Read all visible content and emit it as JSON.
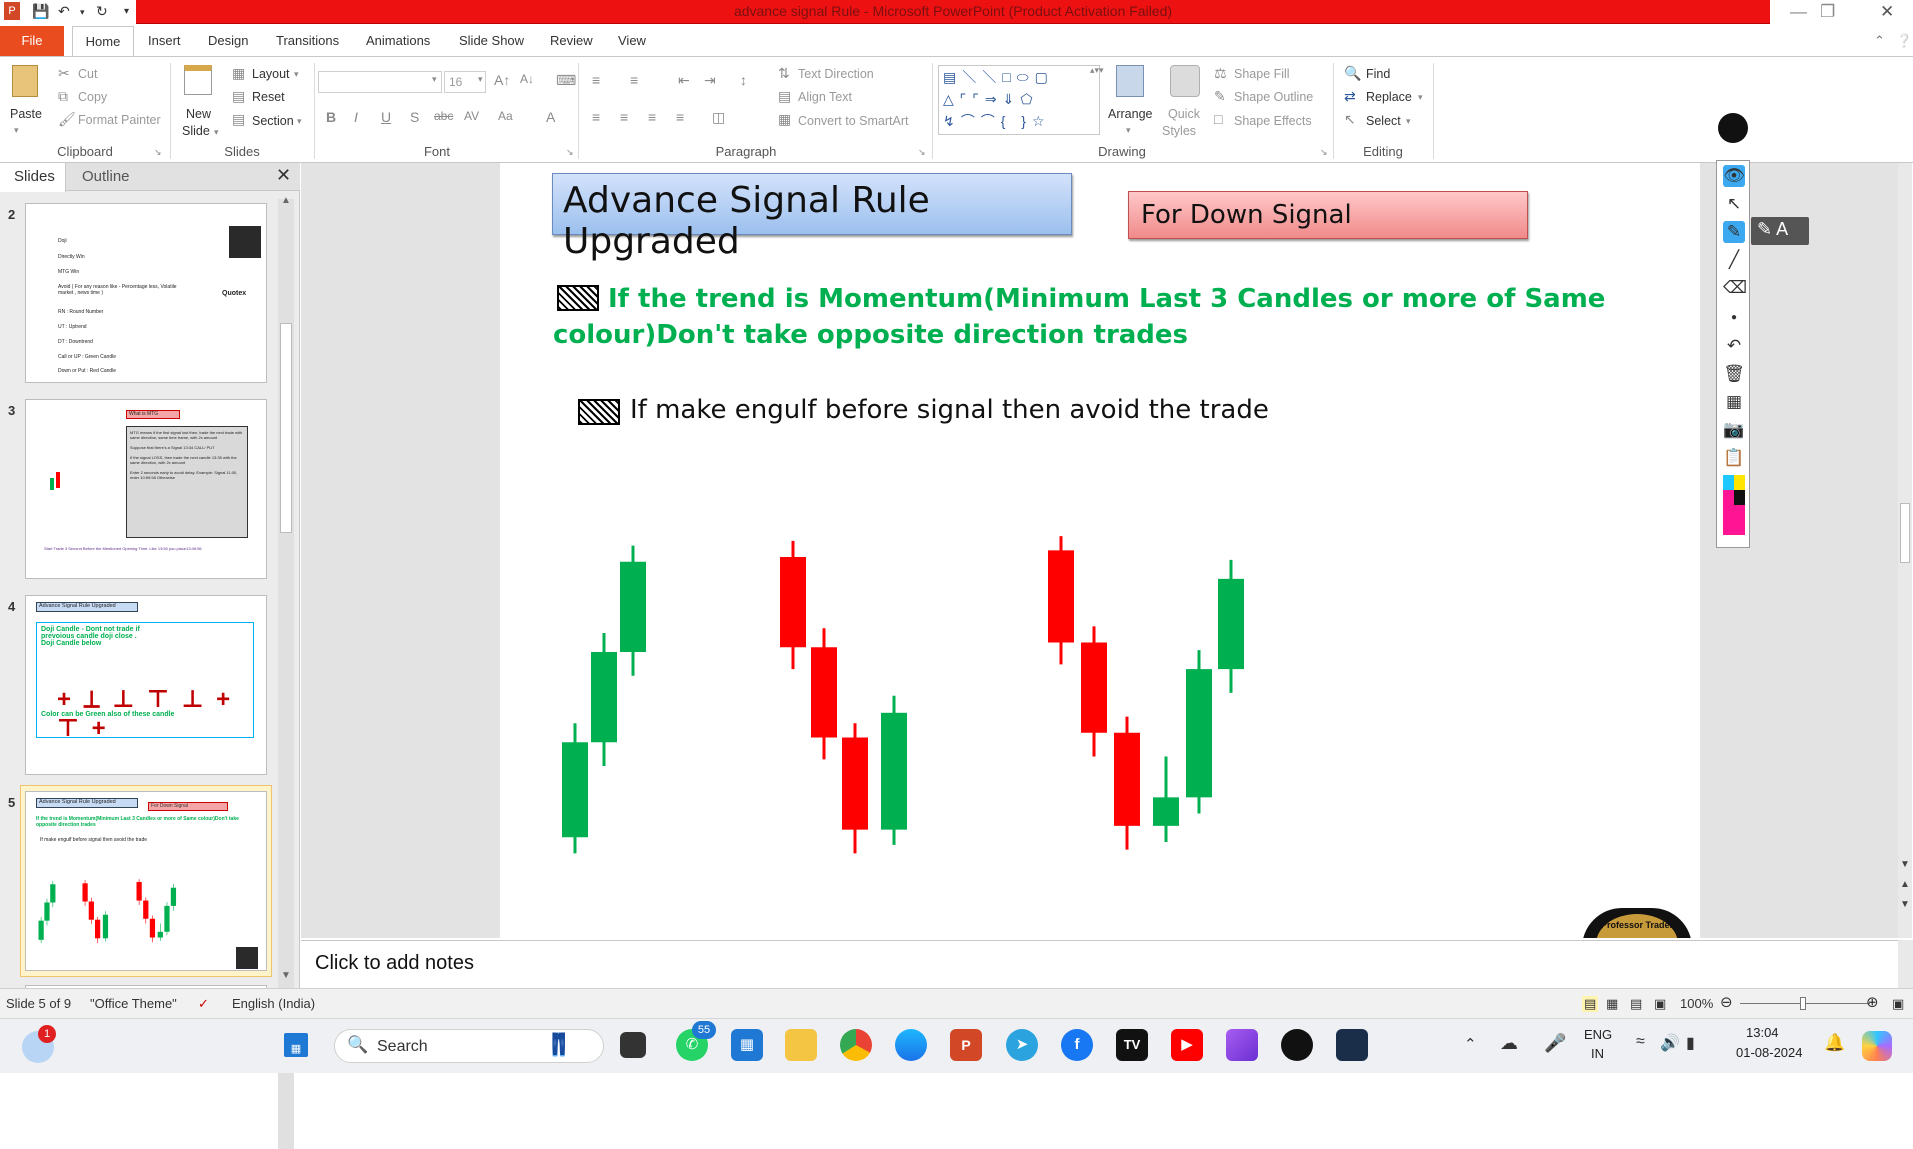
{
  "window": {
    "title": "advance signal Rule  -  Microsoft PowerPoint (Product Activation Failed)"
  },
  "tabs": [
    "File",
    "Home",
    "Insert",
    "Design",
    "Transitions",
    "Animations",
    "Slide Show",
    "Review",
    "View"
  ],
  "ribbon": {
    "clipboard": {
      "group": "Clipboard",
      "paste": "Paste",
      "cut": "Cut",
      "copy": "Copy",
      "format_painter": "Format Painter"
    },
    "slides": {
      "group": "Slides",
      "new_slide_1": "New",
      "new_slide_2": "Slide",
      "layout": "Layout",
      "reset": "Reset",
      "section": "Section"
    },
    "font": {
      "group": "Font",
      "size": "16"
    },
    "paragraph": {
      "group": "Paragraph",
      "text_direction": "Text Direction",
      "align_text": "Align Text",
      "convert": "Convert to SmartArt"
    },
    "drawing": {
      "group": "Drawing",
      "arrange": "Arrange",
      "quick_1": "Quick",
      "quick_2": "Styles",
      "shape_fill": "Shape Fill",
      "shape_outline": "Shape Outline",
      "shape_effects": "Shape Effects"
    },
    "editing": {
      "group": "Editing",
      "find": "Find",
      "replace": "Replace",
      "select": "Select"
    }
  },
  "pane": {
    "tab_slides": "Slides",
    "tab_outline": "Outline"
  },
  "thumbs": {
    "n2": "2",
    "n3": "3",
    "n4": "4",
    "n5": "5",
    "t2": {
      "l1": "Doji",
      "l2": "Directly Win",
      "l3": "MTG Win",
      "l4": "Avoid ( For any reason like - Percentage less, Volatile market , news time )",
      "l5": "RN : Round Number",
      "l6": "UT : Uptrend",
      "l7": "DT : Downtrend",
      "l8": "Call or UP  : Green Candle",
      "l9": "Down or Put  : Red Candle",
      "brand": "Quotex"
    },
    "t3": {
      "title": "What is MTG",
      "b1": "MTG means if the first signal lost  then, trade the next trade with same direction, same time frame, with 2x amount",
      "b2": "Suppose that there's a Signal 13:34 CALL/ PUT",
      "b3": "If the signal LOSS, then trade the next candle 13:35 with the same direction, with 2x amount",
      "b4": "Enter 2 seconds early to avoid delay. Example: Signal 11:00, enter 10:59:58 Otherwise",
      "foot": "Start Trade 3 Second Before the Mentioned  Opening Time, Like 13:50 you place13:49:56"
    },
    "t4": {
      "title": "Advance Signal Rule Upgraded",
      "t1": "Doji Candle - Dont not trade if prevoious candle doji close . Doji Candle below",
      "t2": "Color can be Green also of these candle"
    },
    "t5": {
      "title": "Advance Signal Rule Upgraded",
      "tag": "For Down Signal",
      "l1": "If the trend is Momentum(Minimum  Last 3 Candles  or more of Same colour)Don't take opposite  direction  trades",
      "l2": "If make engulf before  signal then avoid the trade"
    }
  },
  "slide": {
    "title": "Advance Signal Rule Upgraded",
    "tag": "For Down Signal",
    "rule1": "If  the trend is Momentum(Minimum  Last 3 Candles  or more of Same colour)Don't take opposite direction trades",
    "rule2": "If make engulf before  signal then avoid the trade",
    "logo_text": "Professor Trader"
  },
  "candles": [
    {
      "name": "group1-c1",
      "color": "green",
      "open": 1.25,
      "close": 2.25,
      "high": 2.45,
      "low": 1.08
    },
    {
      "name": "group1-c2",
      "color": "green",
      "open": 2.25,
      "close": 3.2,
      "high": 3.4,
      "low": 2.0
    },
    {
      "name": "group1-c3",
      "color": "green",
      "open": 3.2,
      "close": 4.15,
      "high": 4.32,
      "low": 2.95
    },
    {
      "name": "group2-c1",
      "color": "red",
      "open": 4.2,
      "close": 3.25,
      "high": 4.37,
      "low": 3.02
    },
    {
      "name": "group2-c2",
      "color": "red",
      "open": 3.25,
      "close": 2.3,
      "high": 3.45,
      "low": 2.07
    },
    {
      "name": "group2-c3",
      "color": "red",
      "open": 2.3,
      "close": 1.33,
      "high": 2.45,
      "low": 1.08
    },
    {
      "name": "group2-c4",
      "color": "green",
      "open": 1.33,
      "close": 2.56,
      "high": 2.74,
      "low": 1.17
    },
    {
      "name": "group3-c1",
      "color": "red",
      "open": 4.27,
      "close": 3.3,
      "high": 4.42,
      "low": 3.07
    },
    {
      "name": "group3-c2",
      "color": "red",
      "open": 3.3,
      "close": 2.35,
      "high": 3.47,
      "low": 2.1
    },
    {
      "name": "group3-c3",
      "color": "red",
      "open": 2.35,
      "close": 1.37,
      "high": 2.52,
      "low": 1.12
    },
    {
      "name": "group3-c4",
      "color": "green",
      "open": 1.37,
      "close": 1.67,
      "high": 2.1,
      "low": 1.2
    },
    {
      "name": "group3-c5",
      "color": "green",
      "open": 1.67,
      "close": 3.02,
      "high": 3.22,
      "low": 1.5
    },
    {
      "name": "group3-c6",
      "color": "green",
      "open": 3.02,
      "close": 3.97,
      "high": 4.17,
      "low": 2.77
    }
  ],
  "notes": {
    "placeholder": "Click to add notes"
  },
  "status": {
    "slide": "Slide 5 of 9",
    "theme": "\"Office Theme\"",
    "lang": "English (India)",
    "zoom": "100%"
  },
  "taskbar": {
    "search": "Search",
    "badge_weather": "1",
    "badge_whatsapp": "55",
    "lang1": "ENG",
    "lang2": "IN",
    "time": "13:04",
    "date": "01-08-2024"
  },
  "colors": {
    "green": "#00b050",
    "red": "#ff0000",
    "title_bar": "#ee1111",
    "file_tab": "#e84c1f"
  }
}
